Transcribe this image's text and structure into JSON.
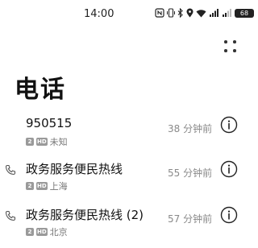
{
  "status_bar": {
    "time": "14:00",
    "battery": "68",
    "icons": [
      "nfc-icon",
      "vibrate-icon",
      "bluetooth-icon",
      "location-icon",
      "wifi-icon",
      "signal-1-icon",
      "signal-2-icon",
      "battery-icon"
    ],
    "signal_labels": [
      "4G",
      "4G"
    ]
  },
  "header": {
    "title": "电话",
    "menu_icon": "more-options-icon"
  },
  "calls": [
    {
      "name": "950515",
      "sim": "2",
      "hd": "HD",
      "location": "未知",
      "time": "38 分钟前",
      "show_call_icon": false
    },
    {
      "name": "政务服务便民热线",
      "sim": "2",
      "hd": "HD",
      "location": "上海",
      "time": "55 分钟前",
      "show_call_icon": true
    },
    {
      "name": "政务服务便民热线 (2)",
      "sim": "2",
      "hd": "HD",
      "location": "北京",
      "time": "57 分钟前",
      "show_call_icon": true
    }
  ],
  "colors": {
    "text_primary": "#111111",
    "text_secondary": "#8a8a8a",
    "badge": "#9a9a9a"
  }
}
